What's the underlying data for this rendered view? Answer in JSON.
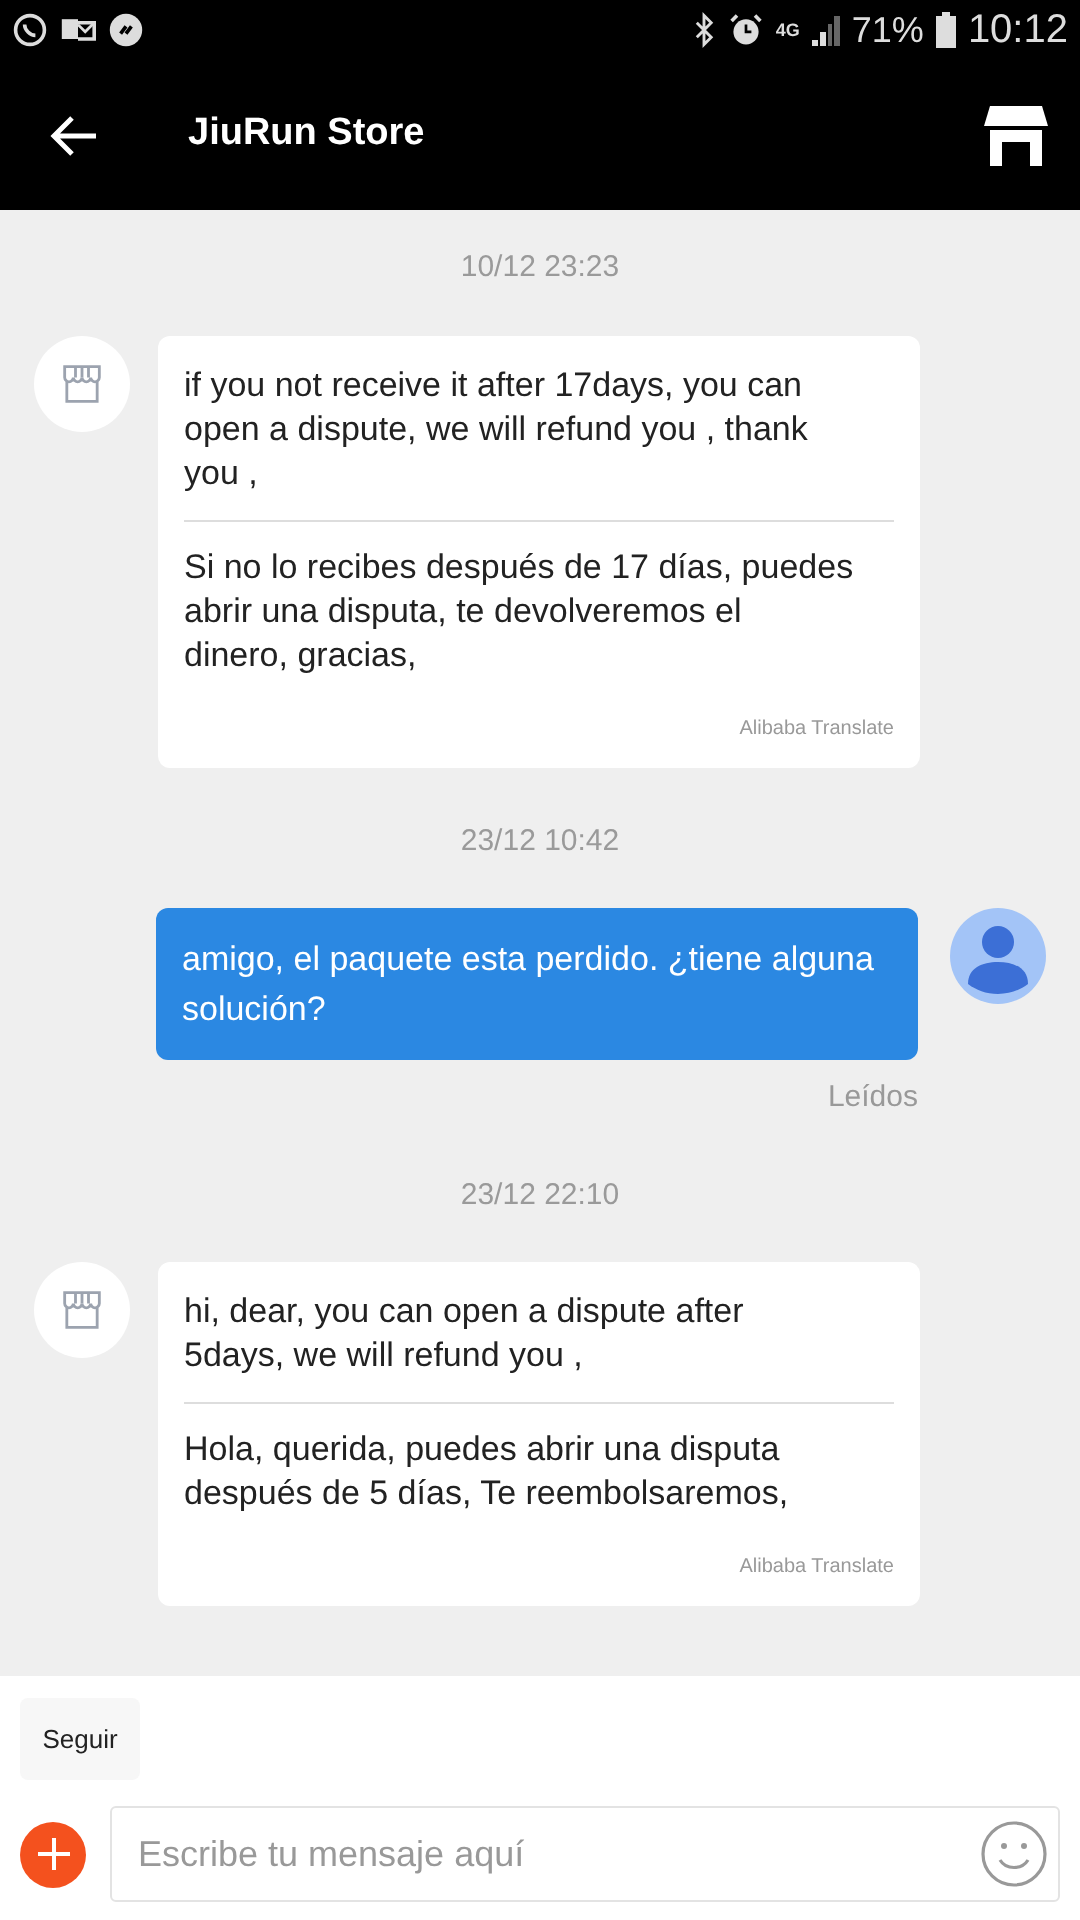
{
  "status_bar": {
    "battery": "71%",
    "time": "10:12",
    "network": "4G"
  },
  "header": {
    "title": "JiuRun Store"
  },
  "messages": [
    {
      "time": "10/12 23:23",
      "kind": "store",
      "text": "if you not receive it after 17days, you can open a dispute, we will refund you , thank you ,",
      "translation": "Si no lo recibes después de 17 días, puedes abrir una disputa, te devolveremos el dinero, gracias,",
      "translator": "Alibaba Translate"
    },
    {
      "time": "23/12 10:42",
      "kind": "me",
      "text": "amigo, el paquete esta perdido. ¿tiene alguna solución?",
      "receipt": "Leídos"
    },
    {
      "time": "23/12 22:10",
      "kind": "store",
      "text": "hi, dear, you can open a dispute after 5days, we will refund you ,",
      "translation": "Hola, querida, puedes abrir una disputa después de 5 días, Te reembolsaremos,",
      "translator": "Alibaba Translate"
    }
  ],
  "quick_reply": "Seguir",
  "composer": {
    "placeholder": "Escribe tu mensaje aquí"
  }
}
